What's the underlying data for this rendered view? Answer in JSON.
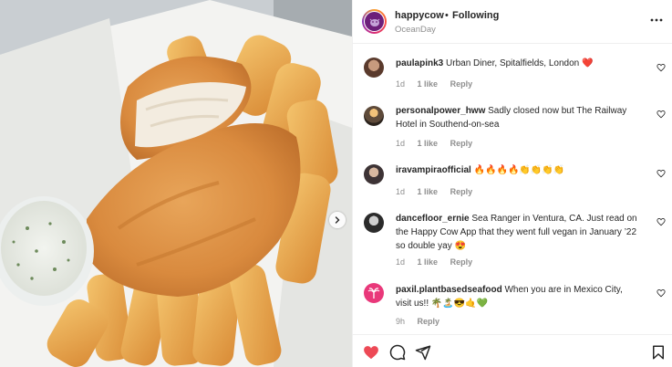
{
  "post": {
    "username": "happycow",
    "separator": "•",
    "follow_state": "Following",
    "location": "OceanDay"
  },
  "comments": [
    {
      "user": "paulapink3",
      "text": "Urban Diner, Spitalfields, London ❤️",
      "time": "1d",
      "likes": "1 like",
      "reply": "Reply"
    },
    {
      "user": "personalpower_hww",
      "text": "Sadly closed now but The Railway Hotel in Southend-on-sea",
      "time": "1d",
      "likes": "1 like",
      "reply": "Reply"
    },
    {
      "user": "iravampiraofficial",
      "text": "🔥🔥🔥🔥👏👏👏👏",
      "time": "1d",
      "likes": "1 like",
      "reply": "Reply"
    },
    {
      "user": "dancefloor_ernie",
      "text": "Sea Ranger in Ventura, CA. Just read on the Happy Cow App that they went full vegan in January ’22 so double yay 😍",
      "time": "1d",
      "likes": "1 like",
      "reply": "Reply"
    },
    {
      "user": "paxil.plantbasedseafood",
      "text": "When you are in Mexico City, visit us!! 🌴🏝️😎🤙💚",
      "time": "9h",
      "likes": "",
      "reply": "Reply"
    }
  ],
  "icons": {
    "more": "more-horizontal-icon",
    "next": "chevron-right-icon",
    "like": "heart-filled-icon",
    "comment": "comment-bubble-icon",
    "share": "paper-plane-icon",
    "save": "bookmark-icon",
    "comment_like": "heart-outline-icon"
  },
  "colors": {
    "like_red": "#ed4956",
    "text": "#262626",
    "muted": "#8e8e8e"
  }
}
